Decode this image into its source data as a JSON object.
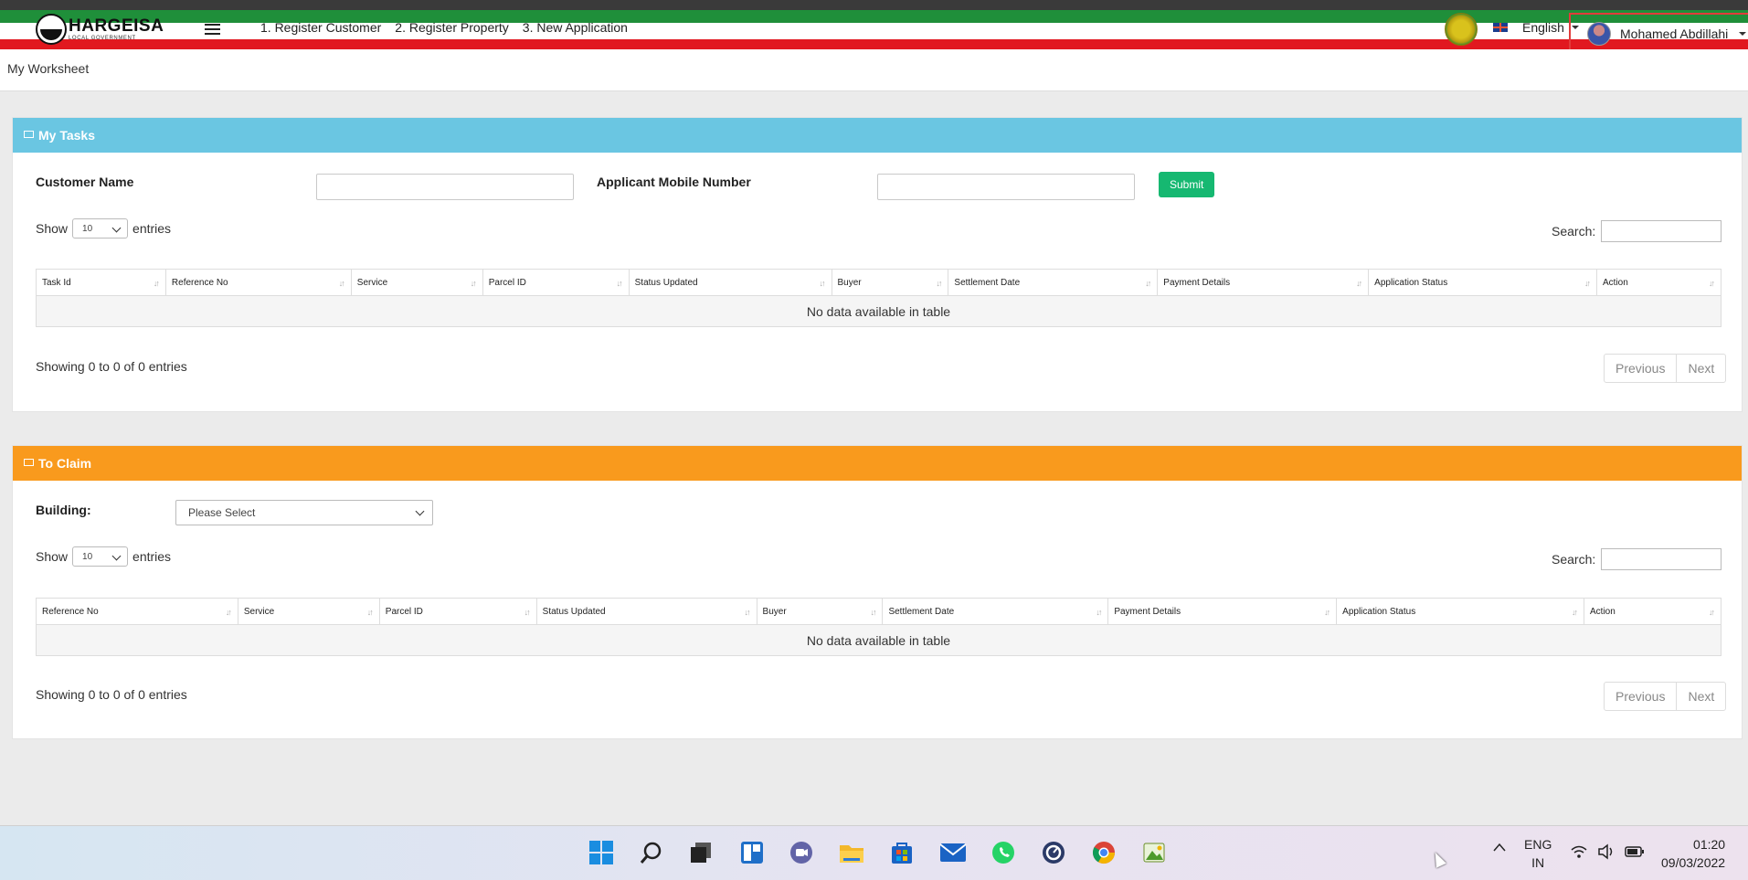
{
  "header": {
    "logo_text": "HARGEISA",
    "logo_sub": "LOCAL GOVERNMENT",
    "nav": [
      "1. Register Customer",
      "2. Register Property",
      "3. New Application"
    ],
    "language": "English",
    "user_name": "Mohamed Abdillahi"
  },
  "worksheet": {
    "title": "My Worksheet"
  },
  "my_tasks": {
    "title": "My Tasks",
    "customer_name_label": "Customer Name",
    "mobile_label": "Applicant Mobile Number",
    "submit_label": "Submit",
    "show_label": "Show",
    "entries_value": "10",
    "entries_label": "entries",
    "search_label": "Search:",
    "columns": [
      "Task Id",
      "Reference No",
      "Service",
      "Parcel ID",
      "Status Updated",
      "Buyer",
      "Settlement Date",
      "Payment Details",
      "Application Status",
      "Action"
    ],
    "empty_message": "No data available in table",
    "info": "Showing 0 to 0 of 0 entries",
    "prev_label": "Previous",
    "next_label": "Next"
  },
  "to_claim": {
    "title": "To Claim",
    "building_label": "Building:",
    "building_value": "Please Select",
    "show_label": "Show",
    "entries_value": "10",
    "entries_label": "entries",
    "search_label": "Search:",
    "columns": [
      "Reference No",
      "Service",
      "Parcel ID",
      "Status Updated",
      "Buyer",
      "Settlement Date",
      "Payment Details",
      "Application Status",
      "Action"
    ],
    "empty_message": "No data available in table",
    "info": "Showing 0 to 0 of 0 entries",
    "prev_label": "Previous",
    "next_label": "Next"
  },
  "taskbar": {
    "icons": [
      "windows-start-icon",
      "search-icon",
      "task-view-icon",
      "widgets-icon",
      "teams-chat-icon",
      "file-explorer-icon",
      "store-icon",
      "mail-icon",
      "whatsapp-icon",
      "app-icon",
      "chrome-icon",
      "image-app-icon"
    ],
    "lang_line1": "ENG",
    "lang_line2": "IN",
    "time": "01:20",
    "date": "09/03/2022"
  },
  "colors": {
    "tasks_header": "#6ac6e2",
    "claim_header": "#f99a1d",
    "submit": "#16b871",
    "flag_green": "#1f8f3a",
    "flag_red": "#e1181f"
  }
}
